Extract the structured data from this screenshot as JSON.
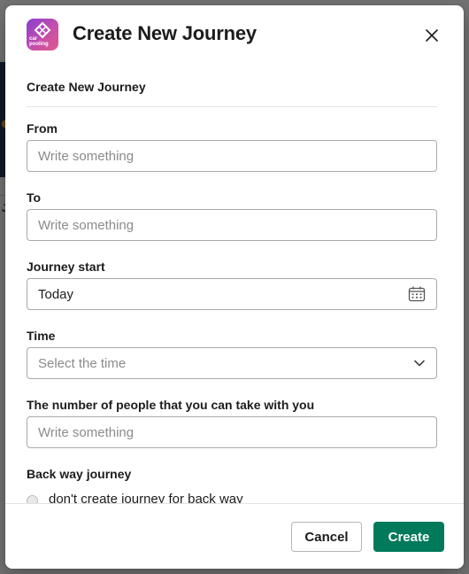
{
  "modal": {
    "title": "Create New Journey",
    "app_logo_text": "car pooling",
    "section_title": "Create New Journey"
  },
  "form": {
    "from": {
      "label": "From",
      "placeholder": "Write something"
    },
    "to": {
      "label": "To",
      "placeholder": "Write something"
    },
    "journey_start": {
      "label": "Journey start",
      "value": "Today",
      "icon": "calendar-icon"
    },
    "time": {
      "label": "Time",
      "placeholder": "Select the time",
      "icon": "chevron-down-icon"
    },
    "people": {
      "label": "The number of people that you can take with you",
      "placeholder": "Write something"
    },
    "back_way": {
      "label": "Back way journey",
      "options": [
        {
          "label": "don't create journey for back way",
          "selected": false
        }
      ]
    }
  },
  "footer": {
    "cancel_label": "Cancel",
    "create_label": "Create"
  },
  "colors": {
    "primary_button": "#007a5a",
    "logo_gradient_start": "#8a3fd1",
    "logo_gradient_end": "#e05a8a"
  }
}
